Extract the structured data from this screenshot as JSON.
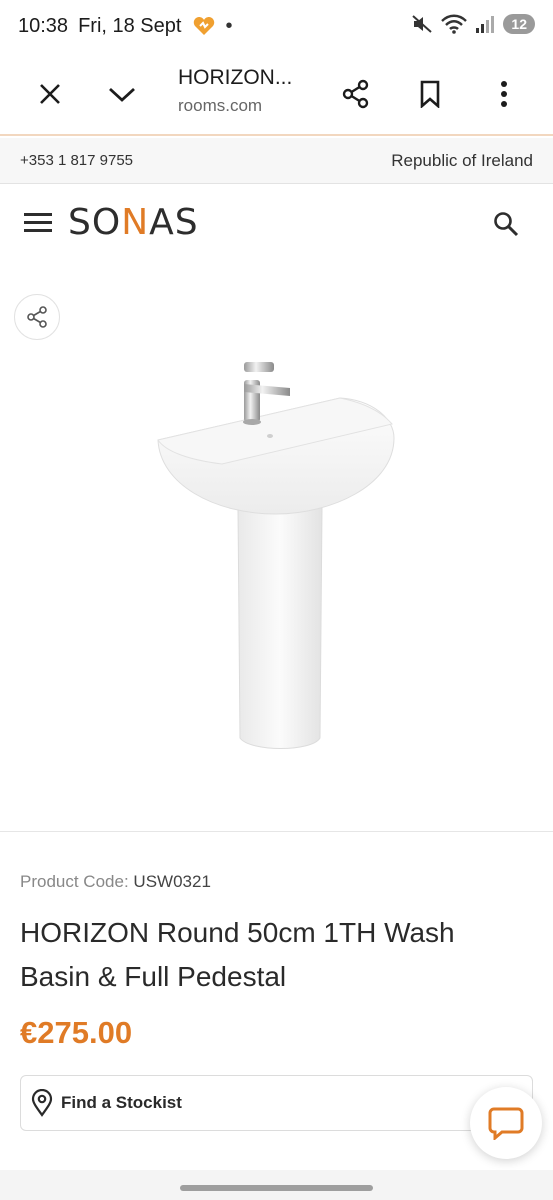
{
  "status_bar": {
    "time": "10:38",
    "date": "Fri, 18 Sept",
    "dot": "•",
    "battery": "12"
  },
  "browser": {
    "title": "HORIZON...",
    "url": "rooms.com",
    "icons": [
      "close-icon",
      "chevron-down-icon",
      "share-icon",
      "bookmark-icon",
      "more-vert-icon"
    ]
  },
  "topbar": {
    "phone": "+353 1 817 9755",
    "region": "Republic of Ireland"
  },
  "header": {
    "logo_pre": "SO",
    "logo_n": "N",
    "logo_post": "AS",
    "icons": [
      "menu-icon",
      "search-icon"
    ]
  },
  "product": {
    "code_label": "Product Code:",
    "code_value": "USW0321",
    "title": "HORIZON Round 50cm 1TH Wash Basin & Full Pedestal",
    "price": "€275.00",
    "stockist_label": "Find a Stockist"
  },
  "colors": {
    "accent": "#e07b26",
    "text": "#2a2a2a"
  }
}
